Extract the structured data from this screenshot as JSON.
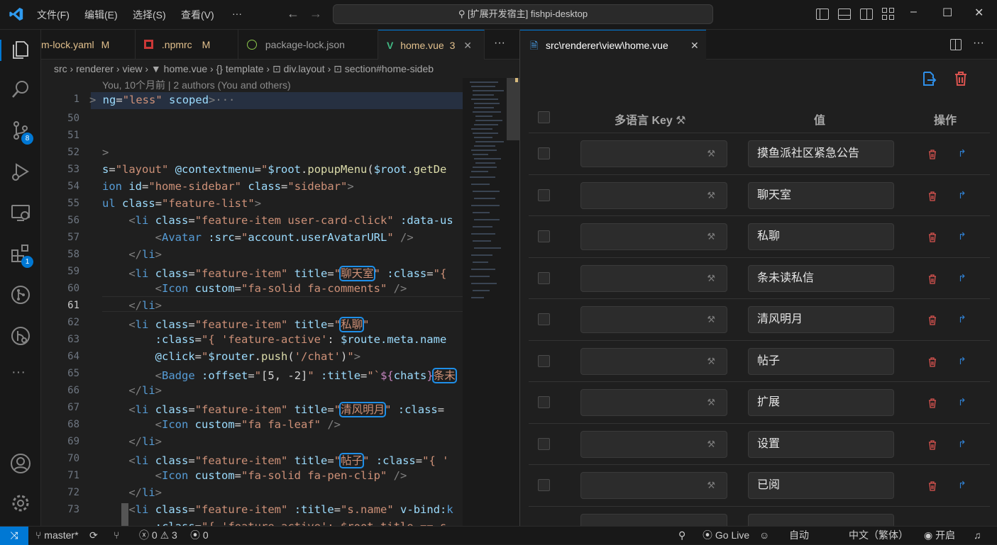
{
  "titlebar": {
    "menus": [
      "文件(F)",
      "编辑(E)",
      "选择(S)",
      "查看(V)",
      "···"
    ],
    "search": "[扩展开发宿主] fishpi-desktop",
    "back": "←",
    "forward": "→",
    "minimize": "–",
    "maximize": "☐",
    "close": "✕"
  },
  "activity": {
    "scm_badge": "8",
    "ext_badge": "1",
    "more": "···"
  },
  "tabs": [
    {
      "label": "m-lock.yaml",
      "flag": "M"
    },
    {
      "label": ".npmrc",
      "flag": "M"
    },
    {
      "label": "package-lock.json",
      "flag": ""
    },
    {
      "label": "home.vue",
      "flag": "3"
    }
  ],
  "breadcrumb": "src  ›  renderer  ›  view  ›  ▼ home.vue  ›  {} template  ›  ⊡ div.layout  ›  ⊡ section#home-sideb",
  "blame": "You, 10个月前 | 2 authors (You and others)",
  "editor": {
    "lines": [
      "1",
      "50",
      "51",
      "52",
      "53",
      "54",
      "55",
      "56",
      "57",
      "58",
      "59",
      "60",
      "61",
      "62",
      "63",
      "64",
      "65",
      "66",
      "67",
      "68",
      "69",
      "70",
      "71",
      "72",
      "73"
    ],
    "current_line": "61"
  },
  "right": {
    "tab_title": "src\\renderer\\view\\home.vue",
    "col_key": "多语言 Key",
    "col_value": "值",
    "col_action": "操作",
    "rows": [
      "摸鱼派社区紧急公告",
      "聊天室",
      "私聊",
      "条未读私信",
      "清风明月",
      "帖子",
      "扩展",
      "设置",
      "已阅"
    ]
  },
  "status": {
    "branch": "master*",
    "errors": "0",
    "warnings": "3",
    "ports": "0",
    "golive": "Go Live",
    "auto": "自动",
    "lang": "中文（繁体）",
    "open": "开启"
  },
  "colors": {
    "accent": "#0078d4",
    "modified": "#e2c08d",
    "vue_green": "#41b883",
    "danger": "#d9534f"
  }
}
